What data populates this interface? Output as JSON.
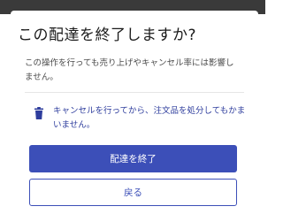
{
  "dialog": {
    "title": "この配達を終了しますか?",
    "description": "この操作を行っても売り上げやキャンセル率には影響しません。",
    "notice": {
      "icon": "trash-icon",
      "text": "キャンセルを行ってから、注文品を処分してもかまいません。"
    },
    "buttons": {
      "end_delivery_label": "配達を終了",
      "back_label": "戻る"
    }
  },
  "colors": {
    "accent": "#3c4fb8",
    "notice_text": "#2e3d9d",
    "top_strip": "#3a3a3a"
  }
}
